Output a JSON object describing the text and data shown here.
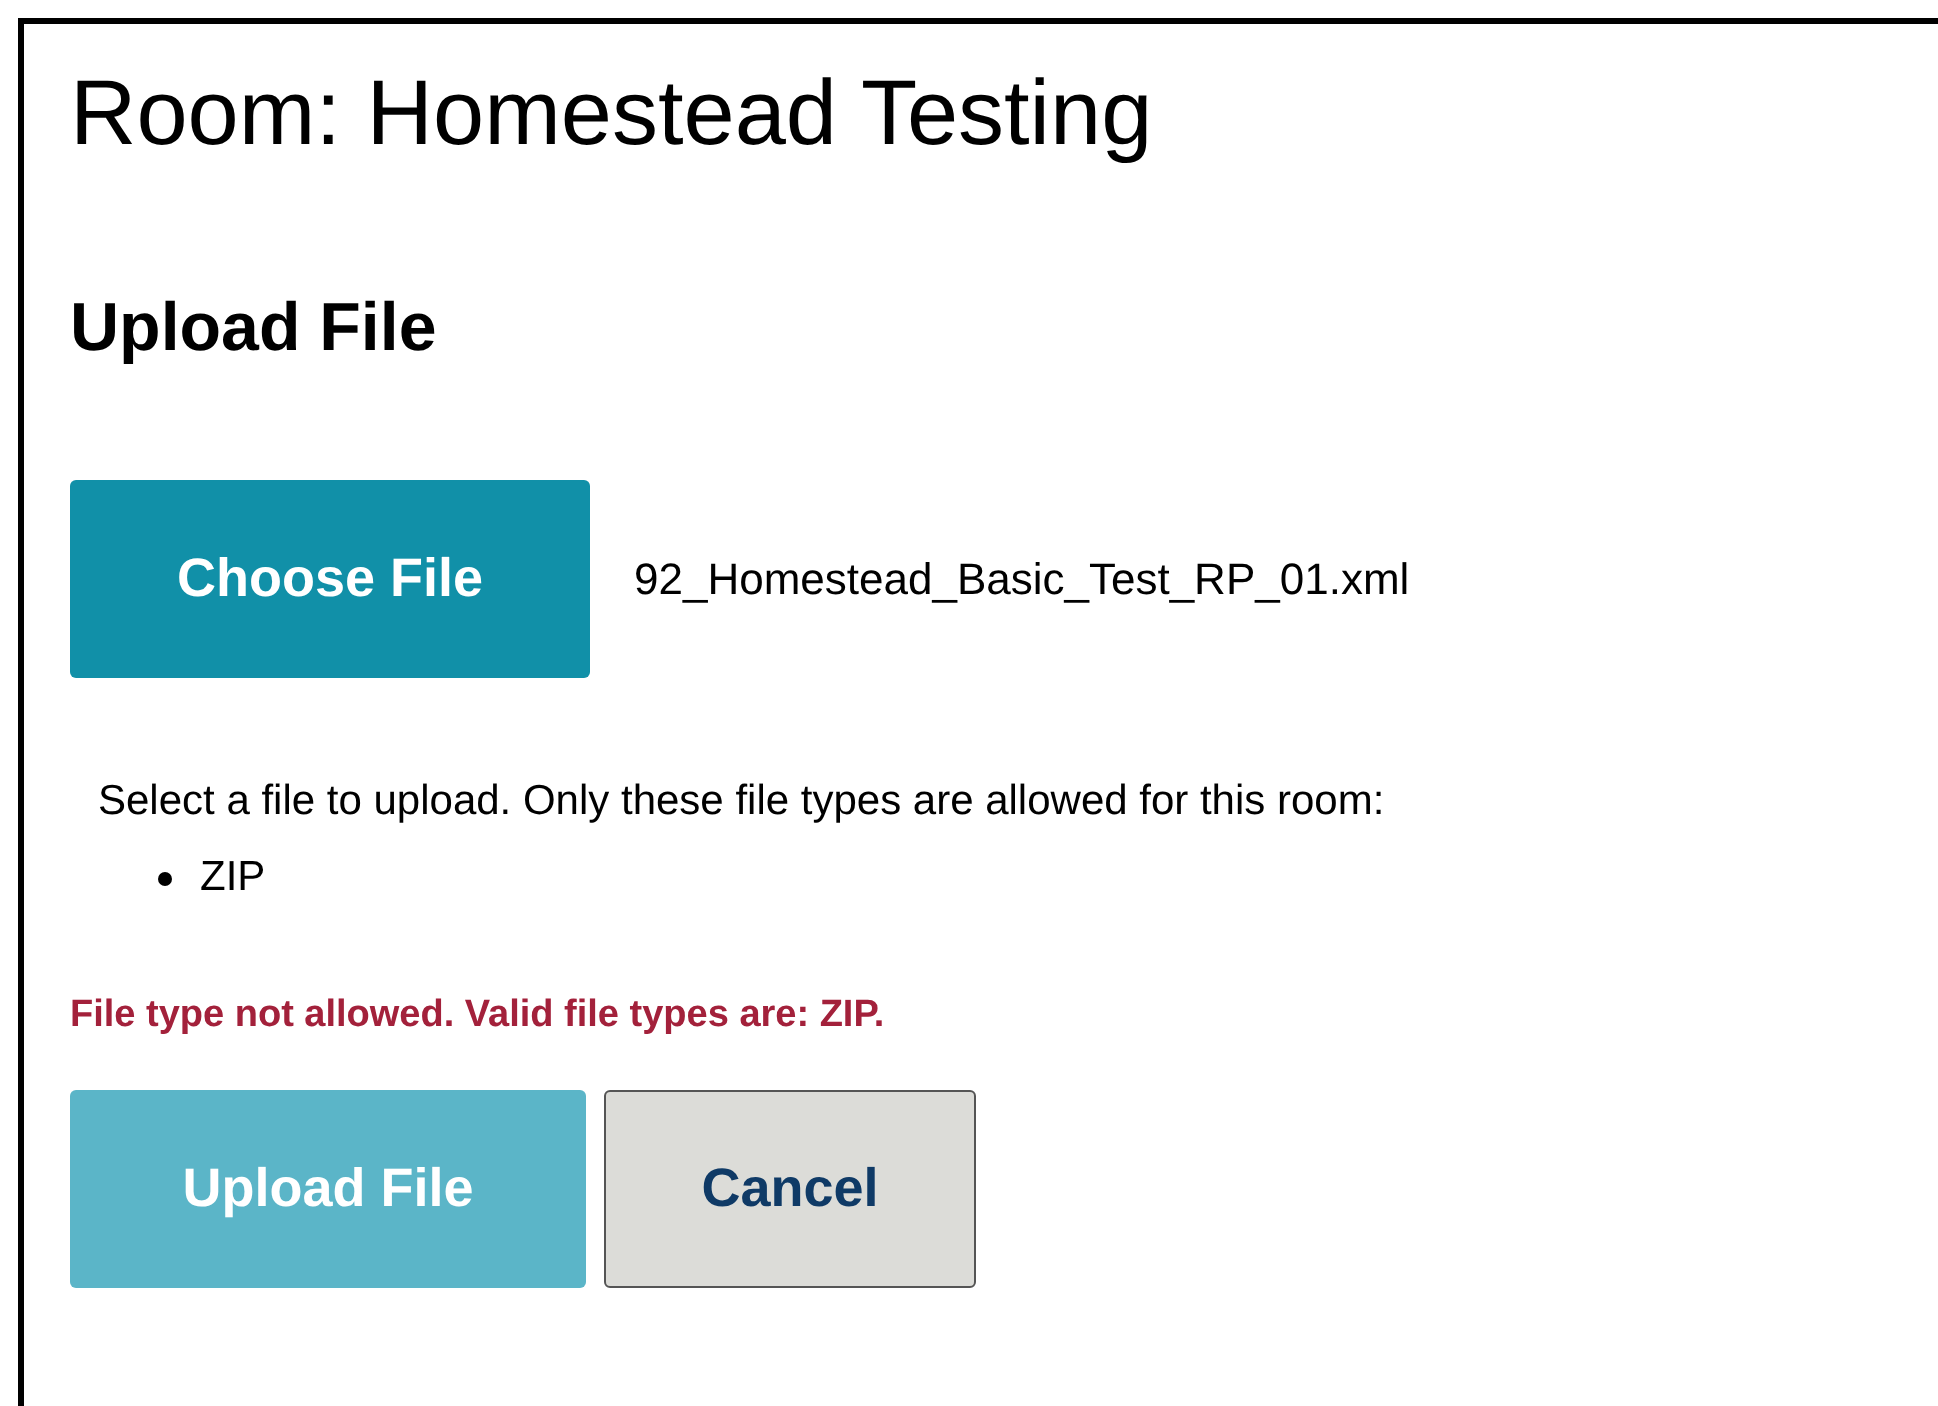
{
  "title": "Room: Homestead Testing",
  "section_title": "Upload File",
  "file_picker": {
    "button": "Choose File",
    "file_name": "92_Homestead_Basic_Test_RP_01.xml"
  },
  "instructions": "Select a file to upload. Only these file types are allowed for this room:",
  "allowed_types": [
    "ZIP"
  ],
  "error": "File type not allowed. Valid file types are: ZIP.",
  "buttons": [
    {
      "label": "Upload File",
      "kind": "primary",
      "disabled": true
    },
    {
      "label": "Cancel",
      "kind": "secondary",
      "disabled": false
    }
  ]
}
